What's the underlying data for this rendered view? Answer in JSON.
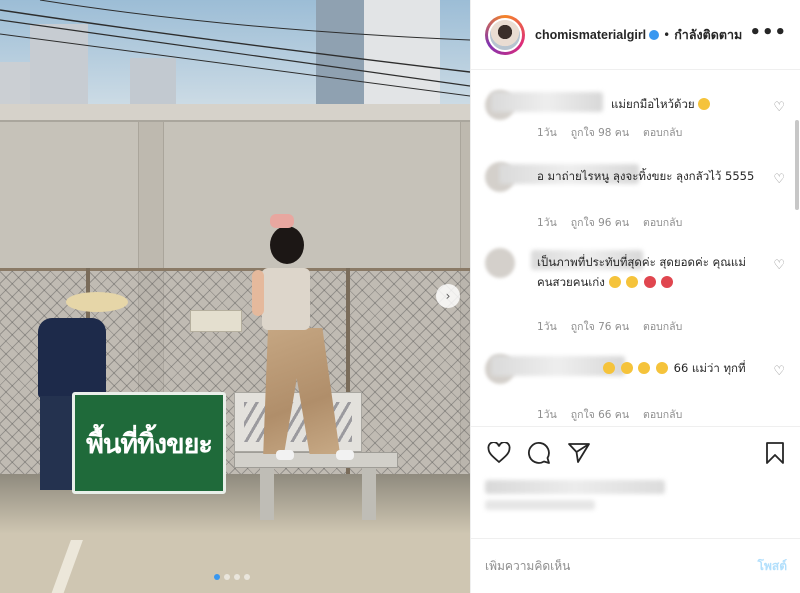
{
  "post": {
    "sign_text": "พื้นที่ทิ้งขยะ",
    "carousel_dots": 4,
    "carousel_active": 1
  },
  "header": {
    "username": "chomismaterialgirl",
    "separator": "•",
    "follow_label": "กำลังติดตาม",
    "more_label": "•••"
  },
  "comments": [
    {
      "text": "แม่ยกมือไหว้ด้วย",
      "emojis": [
        "#f5c33b"
      ],
      "age": "1วัน",
      "likes": "ถูกใจ 98 คน",
      "reply": "ตอบกลับ"
    },
    {
      "text": "อ มาถ่ายไรหนู ลุงจะทิ้งขยะ ลุงกลัวไว้ 5555",
      "emojis": [],
      "age": "1วัน",
      "likes": "ถูกใจ 96 คน",
      "reply": "ตอบกลับ"
    },
    {
      "text": "เป็นภาพที่ประทับที่สุดค่ะ สุดยอดค่ะ คุณแม่คนสวยคนเก่ง",
      "emojis": [
        "#f5c33b",
        "#f5c33b",
        "#e0464f",
        "#e0464f"
      ],
      "age": "1วัน",
      "likes": "ถูกใจ 76 คน",
      "reply": "ตอบกลับ"
    },
    {
      "text": "66 แม่ว่า ทุกที่",
      "emojis": [
        "#f5c33b",
        "#f5c33b",
        "#f5c33b",
        "#f5c33b"
      ],
      "age": "1วัน",
      "likes": "ถูกใจ 66 คน",
      "reply": "ตอบกลับ"
    }
  ],
  "icons": {
    "like": "heart-outline-icon",
    "comment": "comment-bubble-icon",
    "share": "paper-plane-icon",
    "save": "bookmark-icon",
    "next": "chevron-right-icon"
  },
  "composer": {
    "placeholder": "เพิ่มความคิดเห็น",
    "post_label": "โพสต์"
  },
  "colors": {
    "link_blue": "#3897f0",
    "disabled_blue": "#b2dffc",
    "muted_text": "#8e8e8e",
    "sign_green": "#1f6a3a"
  }
}
